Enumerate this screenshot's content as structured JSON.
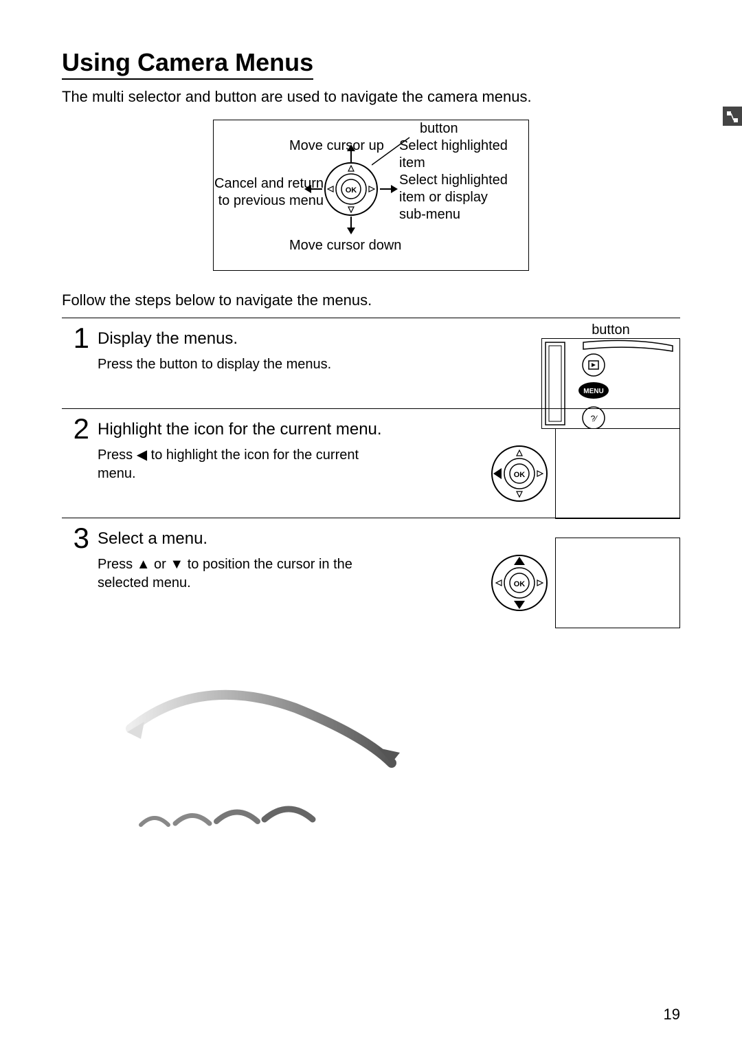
{
  "title": "Using Camera Menus",
  "intro_before": "The multi selector and ",
  "intro_after": " button are used to navigate the camera menus.",
  "diagram": {
    "button_label": "button",
    "up_label": "Move cursor up",
    "ok_label": "Select highlighted item",
    "right_label": "Select highlighted item or display sub-menu",
    "left_label": "Cancel and return to previous menu",
    "down_label": "Move cursor down",
    "ok_text": "OK"
  },
  "follow_text": "Follow the steps below to navigate the menus.",
  "steps": [
    {
      "number": "1",
      "title": "Display the menus.",
      "desc_before": "Press the ",
      "desc_after": " button to display the menus.",
      "media_label": "button"
    },
    {
      "number": "2",
      "title": "Highlight the icon for the current menu.",
      "desc_before": "Press ",
      "desc_mid": " to highlight the icon for the current menu.",
      "ok_text": "OK"
    },
    {
      "number": "3",
      "title": "Select a menu.",
      "desc_before": "Press ",
      "desc_mid": " or ",
      "desc_after": " to position the cursor in the selected menu.",
      "ok_text": "OK"
    }
  ],
  "page_number": "19",
  "menu_label": "MENU"
}
